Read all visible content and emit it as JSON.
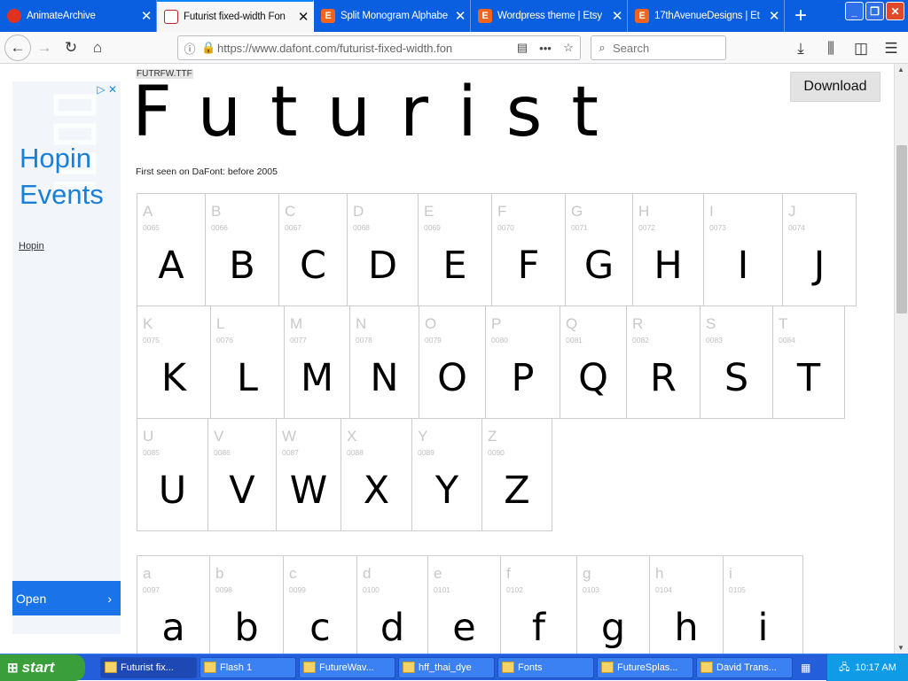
{
  "browser": {
    "tabs": [
      {
        "title": "AnimateArchive",
        "favicon": "animate-icon",
        "fav_text": "",
        "active": false
      },
      {
        "title": "Futurist fixed-width Fon",
        "favicon": "dafont-icon",
        "fav_text": "",
        "active": true
      },
      {
        "title": "Split Monogram Alphabe",
        "favicon": "etsy-icon",
        "fav_text": "E",
        "active": false
      },
      {
        "title": "Wordpress theme | Etsy",
        "favicon": "etsy-icon",
        "fav_text": "E",
        "active": false
      },
      {
        "title": "17thAvenueDesigns | Et",
        "favicon": "etsy-icon",
        "fav_text": "E",
        "active": false
      }
    ],
    "url": "https://www.dafont.com/futurist-fixed-width.fon",
    "search_placeholder": "Search"
  },
  "ad": {
    "headline_line1": "Hopin",
    "headline_line2": "Events",
    "brand": "Hopin",
    "cta": "Open"
  },
  "font": {
    "filename": "FUTRFW.TTF",
    "name": "Futurist",
    "first_seen": "First seen on DaFont: before 2005",
    "download_label": "Download"
  },
  "charmap_upper": [
    [
      {
        "label": "A",
        "code": "0065",
        "glyph": "A"
      },
      {
        "label": "B",
        "code": "0066",
        "glyph": "B"
      },
      {
        "label": "C",
        "code": "0067",
        "glyph": "C"
      },
      {
        "label": "D",
        "code": "0068",
        "glyph": "D"
      },
      {
        "label": "E",
        "code": "0069",
        "glyph": "E"
      },
      {
        "label": "F",
        "code": "0070",
        "glyph": "F"
      },
      {
        "label": "G",
        "code": "0071",
        "glyph": "G"
      },
      {
        "label": "H",
        "code": "0072",
        "glyph": "H"
      },
      {
        "label": "I",
        "code": "0073",
        "glyph": "I"
      },
      {
        "label": "J",
        "code": "0074",
        "glyph": "J"
      }
    ],
    [
      {
        "label": "K",
        "code": "0075",
        "glyph": "K"
      },
      {
        "label": "L",
        "code": "0076",
        "glyph": "L"
      },
      {
        "label": "M",
        "code": "0077",
        "glyph": "M"
      },
      {
        "label": "N",
        "code": "0078",
        "glyph": "N"
      },
      {
        "label": "O",
        "code": "0079",
        "glyph": "O"
      },
      {
        "label": "P",
        "code": "0080",
        "glyph": "P"
      },
      {
        "label": "Q",
        "code": "0081",
        "glyph": "Q"
      },
      {
        "label": "R",
        "code": "0082",
        "glyph": "R"
      },
      {
        "label": "S",
        "code": "0083",
        "glyph": "S"
      },
      {
        "label": "T",
        "code": "0084",
        "glyph": "T"
      }
    ],
    [
      {
        "label": "U",
        "code": "0085",
        "glyph": "U"
      },
      {
        "label": "V",
        "code": "0086",
        "glyph": "V"
      },
      {
        "label": "W",
        "code": "0087",
        "glyph": "W"
      },
      {
        "label": "X",
        "code": "0088",
        "glyph": "X"
      },
      {
        "label": "Y",
        "code": "0089",
        "glyph": "Y"
      },
      {
        "label": "Z",
        "code": "0090",
        "glyph": "Z"
      }
    ]
  ],
  "charmap_lower": [
    [
      {
        "label": "a",
        "code": "0097",
        "glyph": "a"
      },
      {
        "label": "b",
        "code": "0098",
        "glyph": "b"
      },
      {
        "label": "c",
        "code": "0099",
        "glyph": "c"
      },
      {
        "label": "d",
        "code": "0100",
        "glyph": "d"
      },
      {
        "label": "e",
        "code": "0101",
        "glyph": "e"
      },
      {
        "label": "f",
        "code": "0102",
        "glyph": "f"
      },
      {
        "label": "g",
        "code": "0103",
        "glyph": "g"
      },
      {
        "label": "h",
        "code": "0104",
        "glyph": "h"
      },
      {
        "label": "i",
        "code": "0105",
        "glyph": "i"
      }
    ]
  ],
  "taskbar": {
    "start_label": "start",
    "tasks": [
      {
        "label": "Futurist fix...",
        "active": true
      },
      {
        "label": "Flash 1",
        "active": false
      },
      {
        "label": "FutureWav...",
        "active": false
      },
      {
        "label": "hff_thai_dye",
        "active": false
      },
      {
        "label": "Fonts",
        "active": false
      },
      {
        "label": "FutureSplas...",
        "active": false
      },
      {
        "label": "David Trans...",
        "active": false
      }
    ],
    "clock": "10:17 AM"
  },
  "colors": {
    "tabbar": "#0a5fe0",
    "ad_accent": "#1a73e8",
    "taskbar": "#245edb",
    "start": "#3a9e3a"
  }
}
